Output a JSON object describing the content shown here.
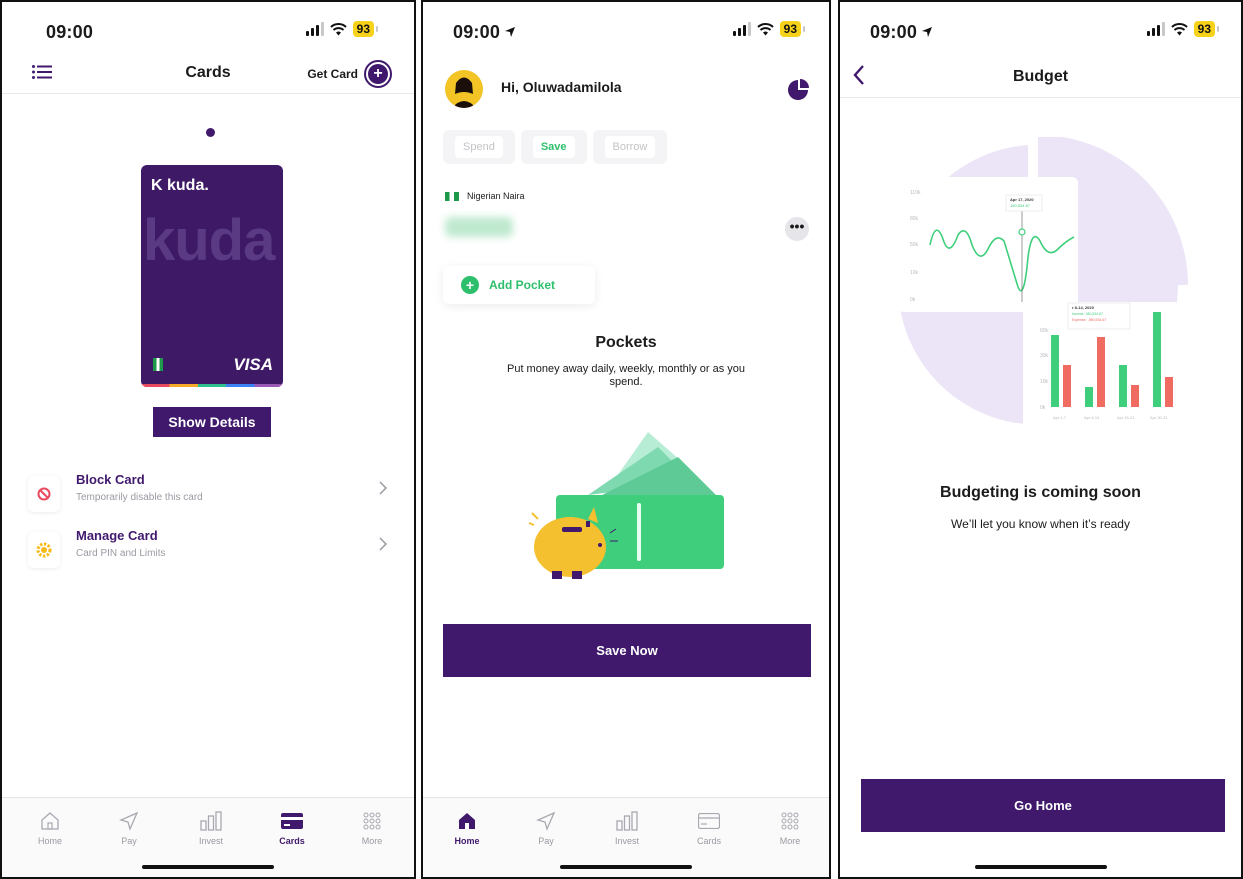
{
  "screen1": {
    "status": {
      "time": "09:00",
      "battery": "93"
    },
    "nav": {
      "title": "Cards",
      "get_card_label": "Get Card"
    },
    "card": {
      "brand": "kuda.",
      "watermark": "kuda",
      "network": "VISA"
    },
    "show_details_label": "Show Details",
    "rows": [
      {
        "title": "Block Card",
        "subtitle": "Temporarily disable this card",
        "icon": "block-icon",
        "icon_color": "#e84a5f"
      },
      {
        "title": "Manage Card",
        "subtitle": "Card PIN and Limits",
        "icon": "gear-icon",
        "icon_color": "#f7b916"
      }
    ],
    "tabs": [
      {
        "label": "Home",
        "icon": "home-icon",
        "active": false
      },
      {
        "label": "Pay",
        "icon": "send-icon",
        "active": false
      },
      {
        "label": "Invest",
        "icon": "bars-icon",
        "active": false
      },
      {
        "label": "Cards",
        "icon": "card-icon",
        "active": true
      },
      {
        "label": "More",
        "icon": "grid-icon",
        "active": false
      }
    ]
  },
  "screen2": {
    "status": {
      "time": "09:00",
      "battery": "93"
    },
    "greeting": "Hi, Oluwadamilola",
    "segments": [
      {
        "label": "Spend",
        "active": false
      },
      {
        "label": "Save",
        "active": true
      },
      {
        "label": "Borrow",
        "active": false
      }
    ],
    "currency": "Nigerian Naira",
    "more_label": "•••",
    "add_pocket_label": "Add Pocket",
    "pockets_title": "Pockets",
    "pockets_description": "Put money away daily, weekly, monthly or as you spend.",
    "save_now_label": "Save Now",
    "tabs": [
      {
        "label": "Home",
        "icon": "home-icon",
        "active": true
      },
      {
        "label": "Pay",
        "icon": "send-icon",
        "active": false
      },
      {
        "label": "Invest",
        "icon": "bars-icon",
        "active": false
      },
      {
        "label": "Cards",
        "icon": "card-icon",
        "active": false
      },
      {
        "label": "More",
        "icon": "grid-icon",
        "active": false
      }
    ]
  },
  "screen3": {
    "status": {
      "time": "09:00",
      "battery": "93"
    },
    "nav": {
      "title": "Budget"
    },
    "illustration": {
      "line_y_ticks": [
        "110k",
        "80k",
        "50k",
        "10k",
        "0k"
      ],
      "line_tooltip_date": "Apr 17, 2020",
      "line_tooltip_value": "180,534.67",
      "bar_tooltip_title": "r 8-14, 2020",
      "bar_tooltip_income": "Income: 180,534.67",
      "bar_tooltip_expense": "Expense: -980,534.67",
      "bar_y_ticks": [
        "60k",
        "30k",
        "10k",
        "0k"
      ],
      "bar_x_labels": [
        "Apr 1-7",
        "Apr 8-14",
        "Apr 15-21",
        "Apr 30-31"
      ]
    },
    "coming_soon_title": "Budgeting is coming soon",
    "coming_soon_subtitle": "We’ll let you know when it’s ready",
    "go_home_label": "Go Home"
  },
  "colors": {
    "brand_purple": "#40196d",
    "accent_green": "#2ebf6c",
    "battery_yellow": "#f7d21b"
  }
}
